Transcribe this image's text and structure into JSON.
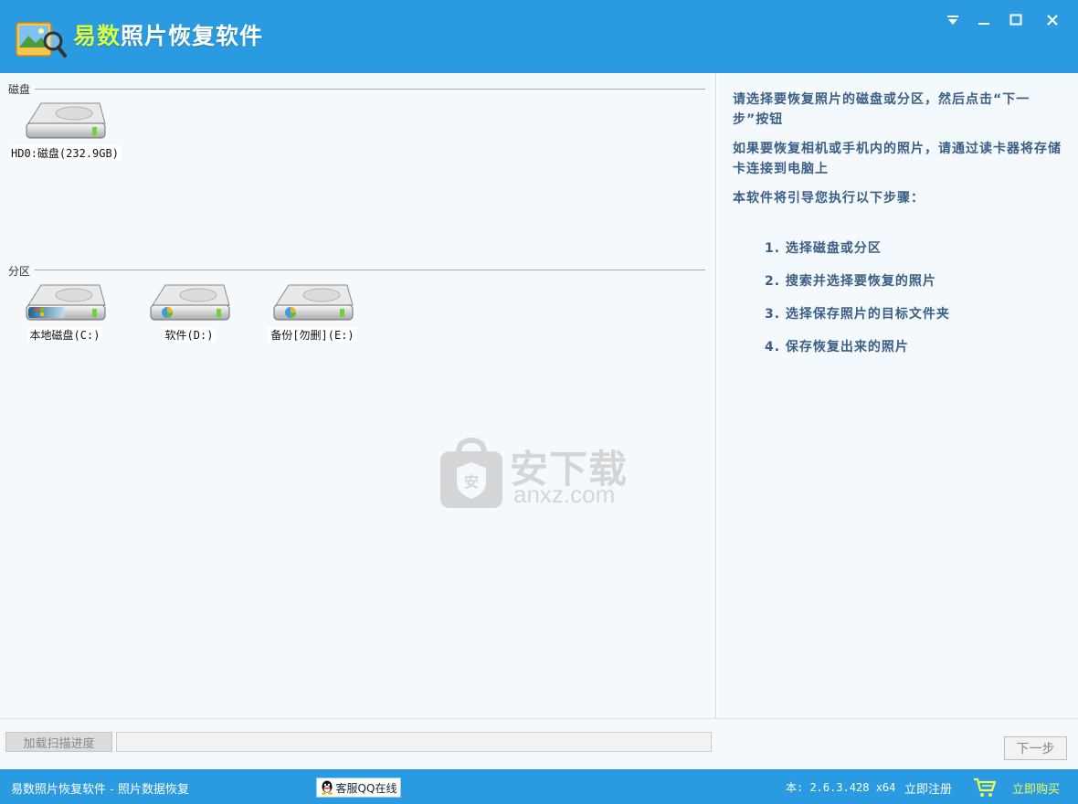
{
  "window": {
    "title_part1": "易数",
    "title_part2": "照片恢复软件",
    "controls": [
      "menu-dropdown-icon",
      "minimize-icon",
      "maximize-icon",
      "close-icon"
    ]
  },
  "disks": {
    "section_label": "磁盘",
    "items": [
      {
        "label": "HD0:磁盘(232.9GB)",
        "icon": "hard-disk-icon"
      }
    ]
  },
  "partitions": {
    "section_label": "分区",
    "items": [
      {
        "label": "本地磁盘(C:)",
        "icon": "system-drive-icon"
      },
      {
        "label": "软件(D:)",
        "icon": "drive-icon"
      },
      {
        "label": "备份[勿删](E:)",
        "icon": "drive-icon"
      }
    ]
  },
  "watermark": {
    "cn": "安下载",
    "en": "anxz.com"
  },
  "instructions": {
    "para1": "请选择要恢复照片的磁盘或分区，然后点击“下一步”按钮",
    "para2": "如果要恢复相机或手机内的照片，请通过读卡器将存储卡连接到电脑上",
    "para3": "本软件将引导您执行以下步骤：",
    "steps": [
      "1.  选择磁盘或分区",
      "2.  搜索并选择要恢复的照片",
      "3.  选择保存照片的目标文件夹",
      "4.  保存恢复出来的照片"
    ]
  },
  "progress": {
    "load_button": "加载扫描进度",
    "next_button": "下一步"
  },
  "statusbar": {
    "app_text": "易数照片恢复软件 - 照片数据恢复",
    "qq_text": "客服QQ在线",
    "version": "本: 2.6.3.428 x64",
    "register": "立即注册",
    "buy": "立即购买"
  },
  "colors": {
    "titlebar": "#2a9be0",
    "panel_bg": "#f4f9fd",
    "instruction_text": "#3b5f86",
    "title_highlight": "#d6ff4a"
  }
}
